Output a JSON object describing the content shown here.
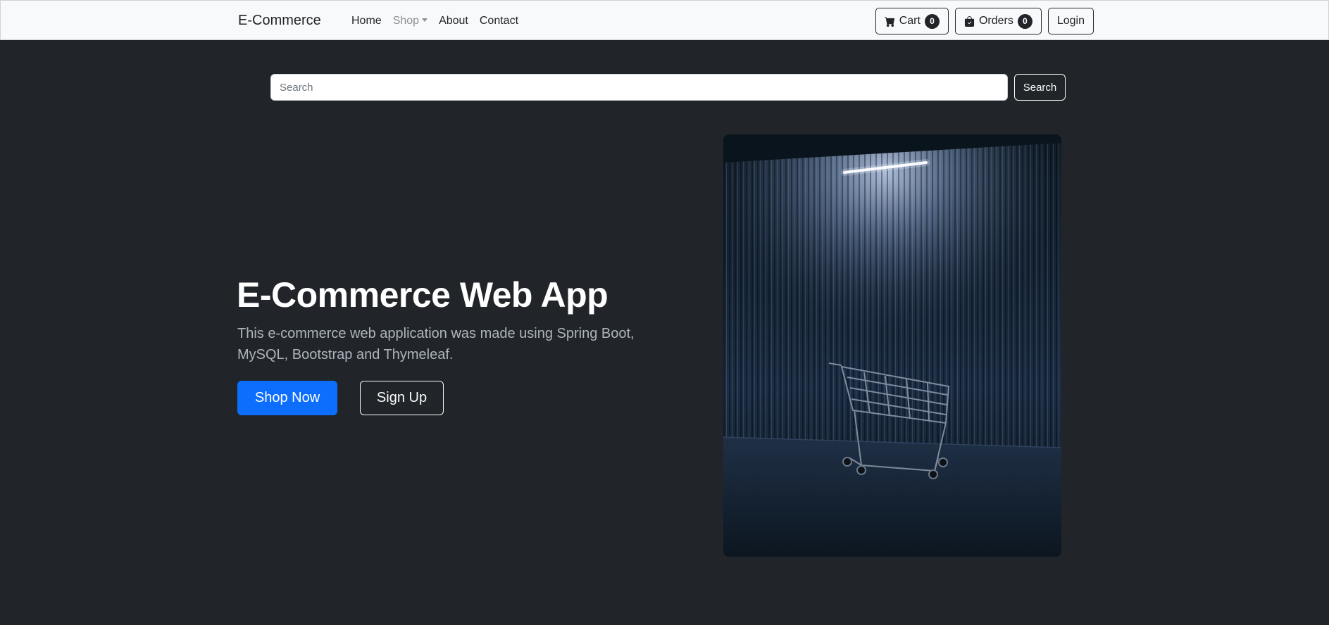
{
  "navbar": {
    "brand": "E-Commerce",
    "links": [
      {
        "label": "Home"
      },
      {
        "label": "Shop"
      },
      {
        "label": "About"
      },
      {
        "label": "Contact"
      }
    ],
    "cart": {
      "label": "Cart",
      "count": "0",
      "icon": "cart-icon"
    },
    "orders": {
      "label": "Orders",
      "count": "0",
      "icon": "bag-icon"
    },
    "login_label": "Login"
  },
  "search": {
    "placeholder": "Search",
    "value": "",
    "button_label": "Search"
  },
  "hero": {
    "title": "E-Commerce Web App",
    "description": "This e-commerce web application was made using Spring Boot, MySQL, Bootstrap and Thymeleaf.",
    "primary_button": "Shop Now",
    "secondary_button": "Sign Up",
    "image": "shopping-cart-in-dark-warehouse"
  },
  "colors": {
    "background": "#212529",
    "navbar": "#f8f9fa",
    "primary": "#0d6efd",
    "muted_text": "#adb5bd"
  }
}
